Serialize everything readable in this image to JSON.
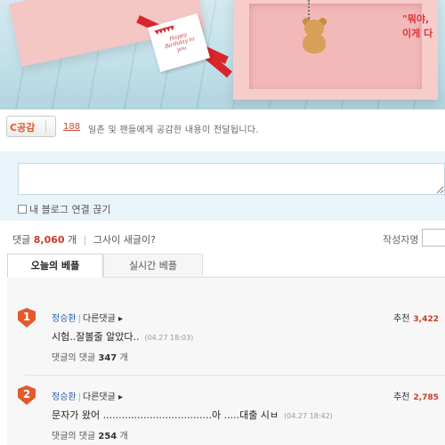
{
  "banner": {
    "card_flags": "▼▼▼▼▼",
    "card_text": "Happy Birthday to you",
    "quote_line1": "\"뭐야,",
    "quote_line2": "이게 다"
  },
  "empathy": {
    "button_label": "C공감",
    "count": "188",
    "description": "일촌 및 팬들에게 공감한 내용이 전달됩니다."
  },
  "comment_form": {
    "input_value": "",
    "blog_unlink_label": "내 블로그 연결 끊기"
  },
  "summary": {
    "comments_label": "댓글",
    "comments_count": "8,060",
    "comments_unit": "개",
    "new_link": "그사이 새글이?",
    "author_label": "작성자명"
  },
  "tabs": [
    {
      "label": "오늘의 베플"
    },
    {
      "label": "실시간 베플"
    }
  ],
  "comments": [
    {
      "rank": "1",
      "author": "정승환",
      "reply_label": "다른댓글",
      "text": "시험..잘볼줄 알았다..",
      "time": "(04.27 18:03)",
      "sub_label": "댓글의 댓글",
      "sub_count": "347",
      "sub_unit": "개",
      "recommend_label": "추천",
      "recommend_count": "3,422"
    },
    {
      "rank": "2",
      "author": "정승환",
      "reply_label": "다른댓글",
      "text": "문자가 왔어 ...................................아 .....대출 시ㅂ",
      "time": "(04.27 18:42)",
      "sub_label": "댓글의 댓글",
      "sub_count": "254",
      "sub_unit": "개",
      "recommend_label": "추천",
      "recommend_count": "2,785"
    }
  ],
  "colors": {
    "accent_orange": "#e45a2b",
    "link_blue": "#2d5fa8",
    "count_red": "#c43b2a",
    "input_area_bg": "#e9f4fa"
  }
}
